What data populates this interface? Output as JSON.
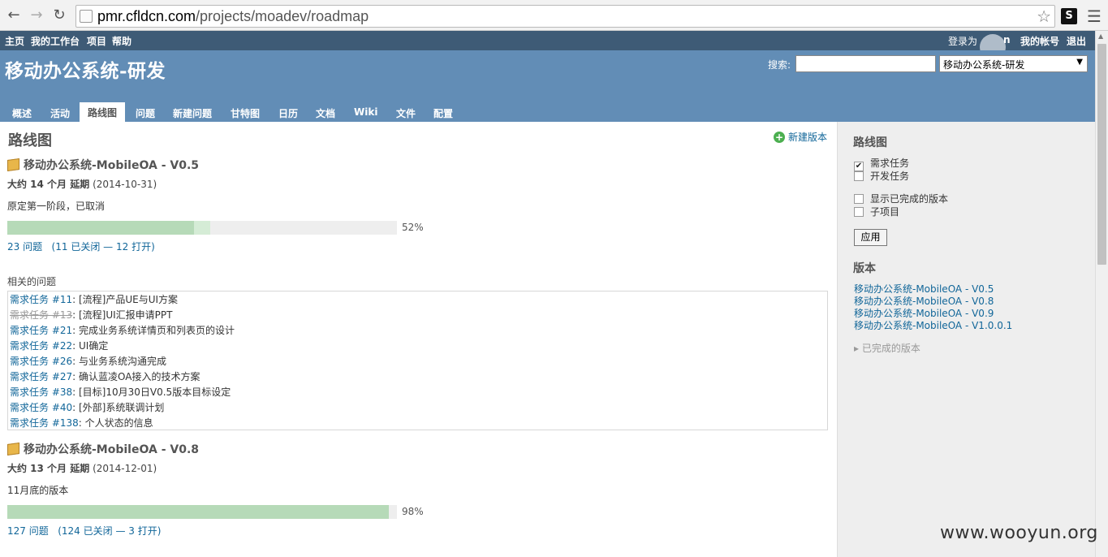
{
  "browser": {
    "url_host": "pmr.cfldcn.com",
    "url_path": "/projects/moadev/roadmap",
    "ext_label": "S"
  },
  "top_menu": {
    "left": [
      "主页",
      "我的工作台",
      "项目",
      "帮助"
    ],
    "logged_as": "登录为",
    "user_fragment": "n",
    "my_account": "我的帐号",
    "logout": "退出"
  },
  "header": {
    "title": "移动办公系统-研发",
    "search_label": "搜索:",
    "project_jump": "移动办公系统-研发"
  },
  "main_menu": [
    "概述",
    "活动",
    "路线图",
    "问题",
    "新建问题",
    "甘特图",
    "日历",
    "文档",
    "Wiki",
    "文件",
    "配置"
  ],
  "main_menu_selected": "路线图",
  "content": {
    "page_title": "路线图",
    "new_version": "新建版本",
    "related_label": "相关的问题",
    "versions": [
      {
        "title": "移动办公系统-MobileOA - V0.5",
        "due_bold": "大约 14 个月 延期",
        "due_date": "(2014-10-31)",
        "description": "原定第一阶段，已取消",
        "closed_pct": 48,
        "done_pct": 52,
        "pct_label": "52%",
        "issues_link": "23 问题",
        "closed_link": "11 已关闭",
        "separator": "—",
        "open_link": "12 打开",
        "paren_open": "(",
        "paren_close": ")"
      },
      {
        "title": "移动办公系统-MobileOA - V0.8",
        "due_bold": "大约 13 个月 延期",
        "due_date": "(2014-12-01)",
        "description": "11月底的版本",
        "closed_pct": 98,
        "done_pct": 98,
        "pct_label": "98%",
        "issues_link": "127 问题",
        "closed_link": "124 已关闭",
        "separator": "—",
        "open_link": "3 打开",
        "paren_open": "(",
        "paren_close": ")"
      }
    ],
    "issues": [
      {
        "ref": "需求任务 #11",
        "subject": ": [流程]产品UE与UI方案",
        "closed": false
      },
      {
        "ref": "需求任务 #13",
        "subject": ": [流程]UI汇报申请PPT",
        "closed": true
      },
      {
        "ref": "需求任务 #21",
        "subject": ": 完成业务系统详情页和列表页的设计",
        "closed": false
      },
      {
        "ref": "需求任务 #22",
        "subject": ": UI确定",
        "closed": false
      },
      {
        "ref": "需求任务 #26",
        "subject": ": 与业务系统沟通完成",
        "closed": false
      },
      {
        "ref": "需求任务 #27",
        "subject": ": 确认蓝凌OA接入的技术方案",
        "closed": false
      },
      {
        "ref": "需求任务 #38",
        "subject": ": [目标]10月30日V0.5版本目标设定",
        "closed": false
      },
      {
        "ref": "需求任务 #40",
        "subject": ": [外部]系统联调计划",
        "closed": false
      },
      {
        "ref": "需求任务 #138",
        "subject": ": 个人状态的信息",
        "closed": false
      }
    ]
  },
  "sidebar": {
    "roadmap_title": "路线图",
    "trackers": [
      {
        "label": "需求任务",
        "checked": true
      },
      {
        "label": "开发任务",
        "checked": false
      }
    ],
    "options": [
      {
        "label": "显示已完成的版本",
        "checked": false
      },
      {
        "label": "子项目",
        "checked": false
      }
    ],
    "apply": "应用",
    "versions_title": "版本",
    "version_links": [
      "移动办公系统-MobileOA - V0.5",
      "移动办公系统-MobileOA - V0.8",
      "移动办公系统-MobileOA - V0.9",
      "移动办公系统-MobileOA - V1.0.0.1"
    ],
    "completed_versions": "已完成的版本"
  },
  "watermark": "www.wooyun.org",
  "colors": {
    "top_menu_bg": "#3e5b76",
    "header_bg": "#628db6",
    "link": "#116699",
    "progress_closed": "#b6dab8",
    "progress_done": "#d5ecd6"
  }
}
